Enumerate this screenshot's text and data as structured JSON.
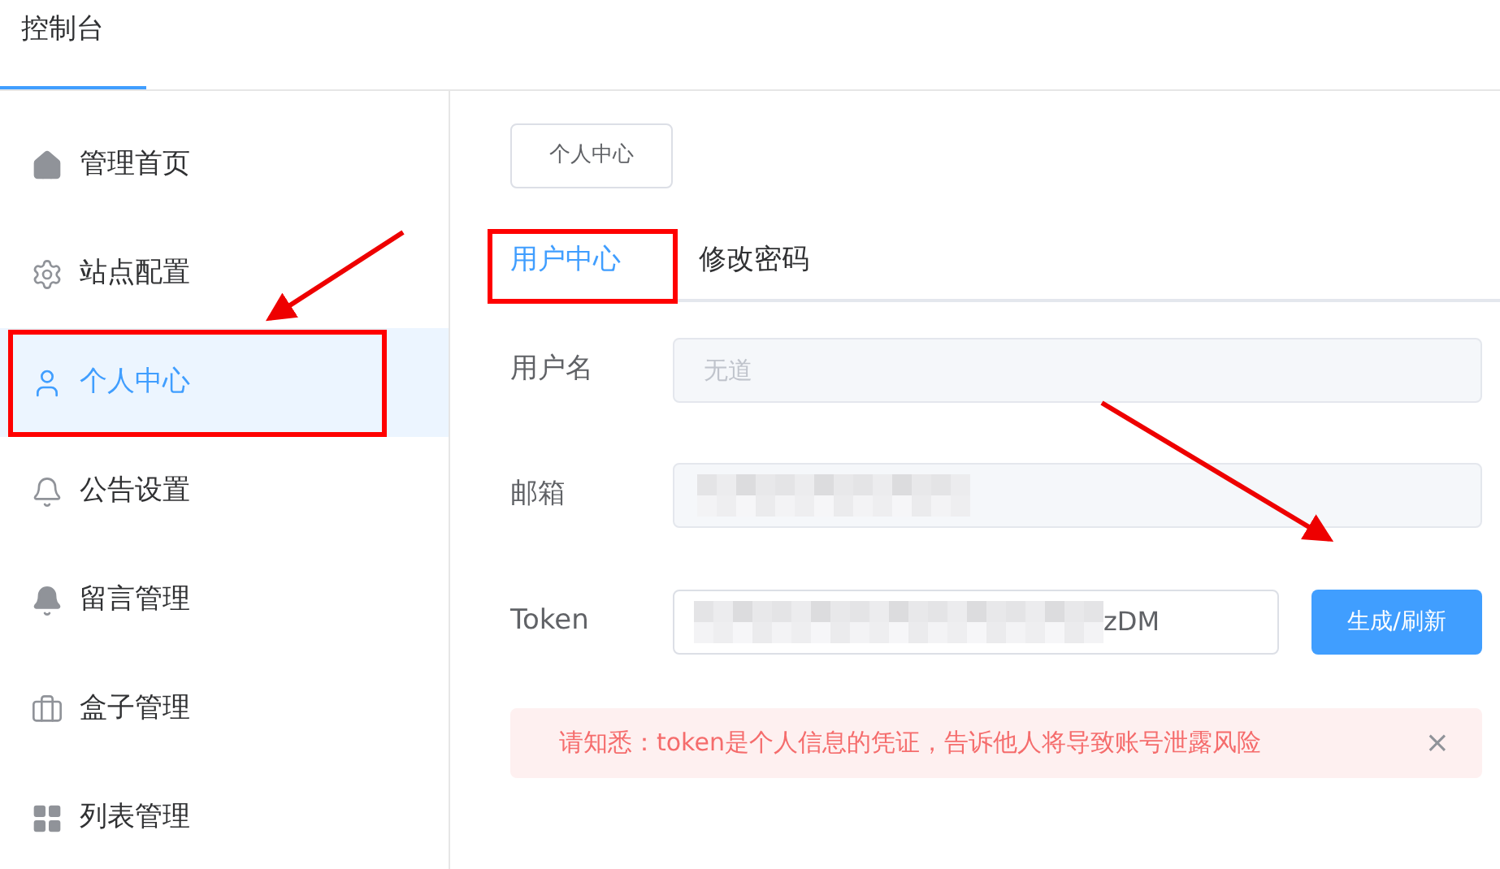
{
  "header": {
    "tabs": [
      {
        "label": "控制台",
        "selected": true
      }
    ]
  },
  "sidebar": {
    "items": [
      {
        "label": "管理首页",
        "selected": false
      },
      {
        "label": "站点配置",
        "selected": false
      },
      {
        "label": "个人中心",
        "selected": true
      },
      {
        "label": "公告设置",
        "selected": false
      },
      {
        "label": "留言管理",
        "selected": false
      },
      {
        "label": "盒子管理",
        "selected": false
      },
      {
        "label": "列表管理",
        "selected": false
      }
    ]
  },
  "breadcrumb_tag": "个人中心",
  "tabs": [
    {
      "label": "用户中心",
      "selected": true
    },
    {
      "label": "修改密码",
      "selected": false
    }
  ],
  "form": {
    "username": {
      "label": "用户名",
      "placeholder": "无道"
    },
    "email": {
      "label": "邮箱"
    },
    "token": {
      "label": "Token",
      "value": "zDM",
      "button": "生成/刷新"
    }
  },
  "alert": {
    "text": "请知悉：token是个人信息的凭证，告诉他人将导致账号泄露风险",
    "close": "×"
  }
}
